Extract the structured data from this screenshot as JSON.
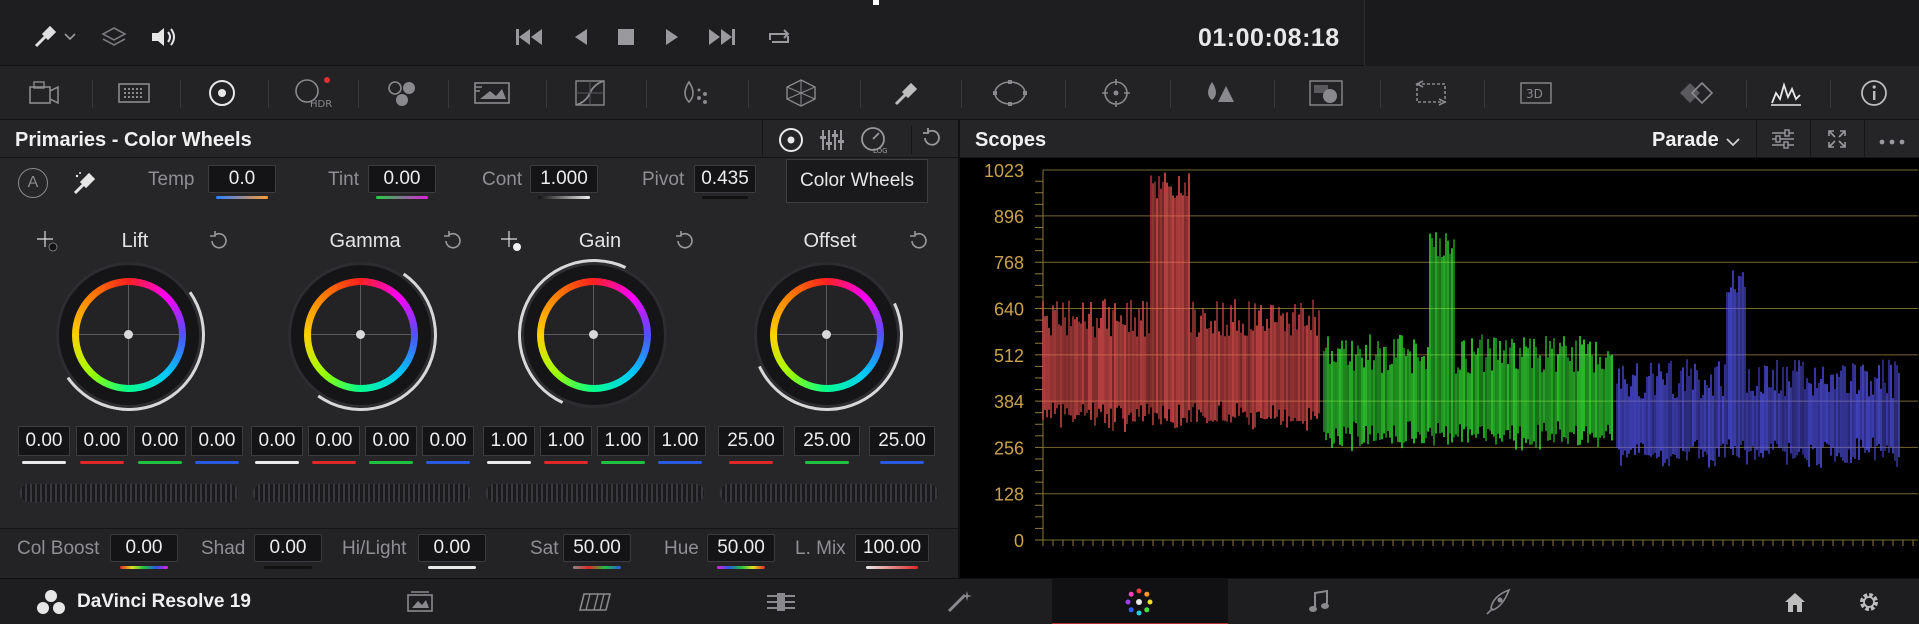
{
  "transport": {
    "timecode": "01:00:08:18",
    "icons": [
      "eyedropper-icon",
      "layers-icon",
      "speaker-icon",
      "skip-back-icon",
      "play-reverse-icon",
      "stop-icon",
      "play-icon",
      "skip-forward-icon",
      "loop-icon"
    ]
  },
  "palette": {
    "icons": [
      "camera-raw-icon",
      "color-match-icon",
      "primaries-wheels-icon",
      "hdr-icon",
      "rgb-mixer-icon",
      "motion-effects-icon",
      "curves-icon",
      "warper-icon",
      "color-warper-icon",
      "qualifier-icon",
      "window-icon",
      "tracker-icon",
      "magic-mask-icon",
      "blur-icon",
      "key-icon",
      "sizing-icon",
      "3d-icon",
      "stereo-icon",
      "scopes-icon",
      "info-icon"
    ],
    "hdr_label": "HDR",
    "threed_label": "3D"
  },
  "primaries": {
    "title": "Primaries - Color Wheels",
    "temp_label": "Temp",
    "temp": "0.0",
    "tint_label": "Tint",
    "tint": "0.00",
    "cont_label": "Cont",
    "cont": "1.000",
    "pivot_label": "Pivot",
    "pivot": "0.435",
    "auto_label": "A",
    "tooltip": "Color Wheels",
    "wheels": [
      {
        "name": "Lift",
        "values": [
          "0.00",
          "0.00",
          "0.00",
          "0.00"
        ]
      },
      {
        "name": "Gamma",
        "values": [
          "0.00",
          "0.00",
          "0.00",
          "0.00"
        ]
      },
      {
        "name": "Gain",
        "values": [
          "1.00",
          "1.00",
          "1.00",
          "1.00"
        ]
      },
      {
        "name": "Offset",
        "values": [
          "25.00",
          "25.00",
          "25.00"
        ]
      }
    ],
    "bottom": {
      "colboost_label": "Col Boost",
      "colboost": "0.00",
      "shad_label": "Shad",
      "shad": "0.00",
      "hilight_label": "Hi/Light",
      "hilight": "0.00",
      "sat_label": "Sat",
      "sat": "50.00",
      "hue_label": "Hue",
      "hue": "50.00",
      "lmix_label": "L. Mix",
      "lmix": "100.00"
    }
  },
  "scopes": {
    "title": "Scopes",
    "mode": "Parade",
    "y_ticks": [
      "1023",
      "896",
      "768",
      "640",
      "512",
      "384",
      "256",
      "128",
      "0"
    ],
    "colors": {
      "red": "#ff5a5a",
      "green": "#3cff3c",
      "blue": "#5a5aff",
      "grid": "#8a7a3a",
      "tick": "#c9a24a"
    }
  },
  "footer": {
    "app_name": "DaVinci Resolve 19",
    "pages": [
      "media-page-icon",
      "cut-page-icon",
      "edit-page-icon",
      "fusion-page-icon",
      "color-page-icon",
      "fairlight-page-icon",
      "deliver-page-icon"
    ]
  }
}
